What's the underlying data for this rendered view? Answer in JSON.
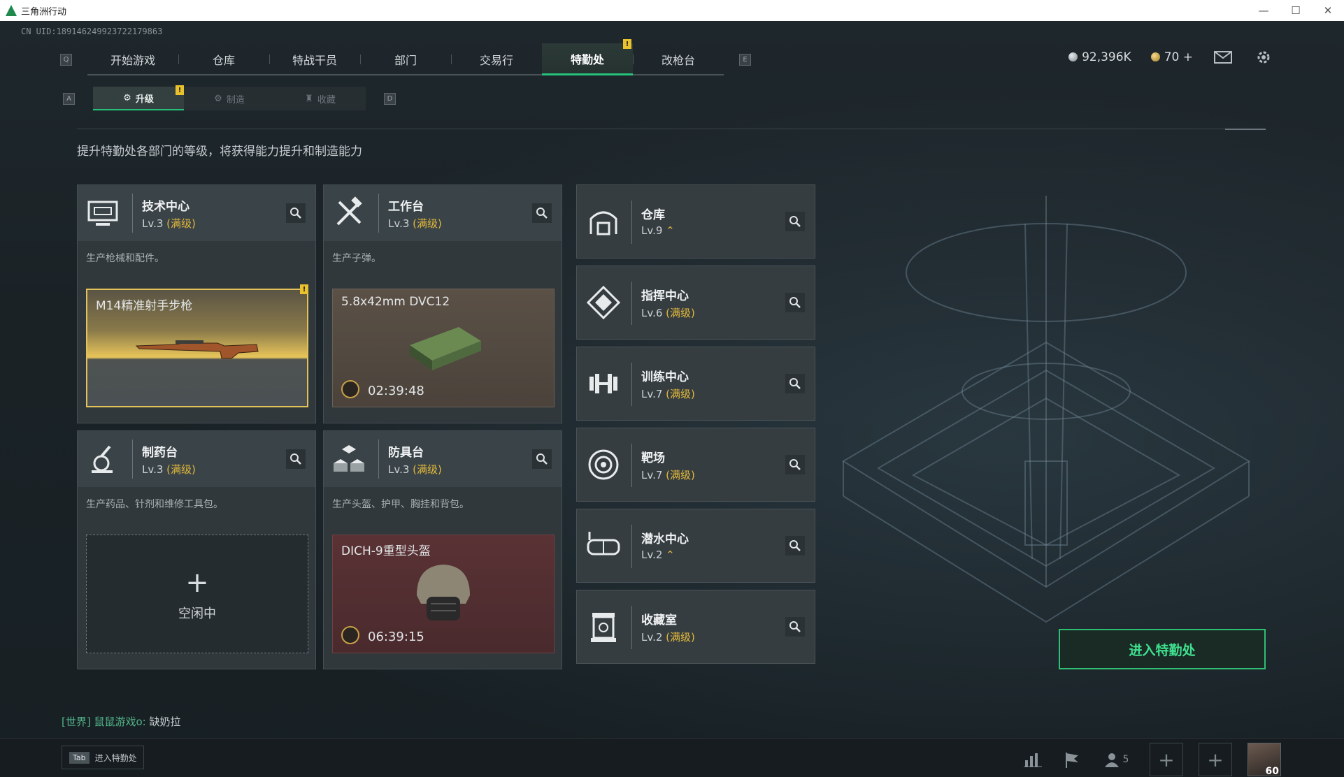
{
  "window": {
    "title": "三角洲行动"
  },
  "account": {
    "uid": "CN UID:18914624992372217986​3"
  },
  "nav": {
    "left_key": "Q",
    "right_key": "E",
    "tabs": [
      {
        "label": "开始游戏"
      },
      {
        "label": "仓库"
      },
      {
        "label": "特战干员"
      },
      {
        "label": "部门"
      },
      {
        "label": "交易行"
      },
      {
        "label": "特勤处",
        "active": true,
        "badge": "!"
      },
      {
        "label": "改枪台"
      }
    ]
  },
  "currency": {
    "silver": "92,396K",
    "gold": "70"
  },
  "subnav": {
    "left_key": "A",
    "right_key": "D",
    "tabs": [
      {
        "label": "升级",
        "active": true,
        "badge": "!"
      },
      {
        "label": "制造"
      },
      {
        "label": "收藏"
      }
    ]
  },
  "page": {
    "description": "提升特勤处各部门的等级，将获得能力提升和制造能力"
  },
  "workshops": [
    {
      "name": "技术中心",
      "level": "Lv.3",
      "max": "(满级)",
      "desc": "生产枪械和配件。",
      "slot": {
        "item": "M14精准射手步枪",
        "badge": "!"
      }
    },
    {
      "name": "工作台",
      "level": "Lv.3",
      "max": "(满级)",
      "desc": "生产子弹。",
      "slot": {
        "item": "5.8x42mm DVC12",
        "time": "02:39:48"
      }
    },
    {
      "name": "制药台",
      "level": "Lv.3",
      "max": "(满级)",
      "desc": "生产药品、针剂和维修工具包。",
      "slot": {
        "idle_icon": "+",
        "idle_label": "空闲中"
      }
    },
    {
      "name": "防具台",
      "level": "Lv.3",
      "max": "(满级)",
      "desc": "生产头盔、护甲、胸挂和背包。",
      "slot": {
        "item": "DICH-9重型头盔",
        "time": "06:39:15"
      }
    }
  ],
  "departments": [
    {
      "name": "仓库",
      "level": "Lv.9",
      "max": "",
      "upgrade": true
    },
    {
      "name": "指挥中心",
      "level": "Lv.6",
      "max": "(满级)"
    },
    {
      "name": "训练中心",
      "level": "Lv.7",
      "max": "(满级)"
    },
    {
      "name": "靶场",
      "level": "Lv.7",
      "max": "(满级)"
    },
    {
      "name": "潜水中心",
      "level": "Lv.2",
      "max": "",
      "upgrade": true
    },
    {
      "name": "收藏室",
      "level": "Lv.2",
      "max": "(满级)"
    }
  ],
  "enter_button": "进入特勤处",
  "chat": {
    "channel": "[世界]",
    "user": "鼠鼠游戏o:",
    "message": "缺奶拉"
  },
  "bottom": {
    "tab_key": "Tab",
    "tab_label": "进入特勤处",
    "friends_count": "5",
    "level": "60"
  },
  "colors": {
    "accent": "#27c27a",
    "max_level": "#e2b83c",
    "warn": "#e9c12d"
  }
}
